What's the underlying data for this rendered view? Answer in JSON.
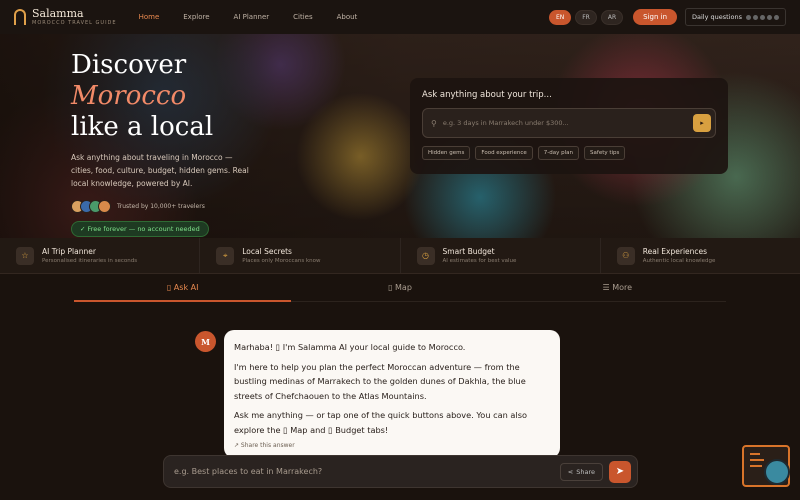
{
  "nav": {
    "brand": "Salamma",
    "brand_sub": "MOROCCO TRAVEL GUIDE",
    "menu": [
      "Home",
      "Explore",
      "AI Planner",
      "Cities",
      "About"
    ],
    "active_menu": "Home",
    "langs": [
      "EN",
      "FR",
      "AR"
    ],
    "signin": "Sign in",
    "daily": "Daily questions"
  },
  "hero": {
    "title_line1_a": "Discover ",
    "title_line1_b": "Morocco",
    "title_line2": "like a local",
    "description": "Ask anything about traveling in Morocco — cities, food, culture, budget, hidden gems. Real local knowledge, powered by AI.",
    "trust": "Trusted by 10,000+ travelers",
    "free_badge": "✓ Free forever — no account needed",
    "avatar_colors": [
      "#d8a060",
      "#3a6aaa",
      "#4a9a6a",
      "#d88a4a"
    ]
  },
  "ask": {
    "title": "Ask anything about your trip...",
    "placeholder": "e.g. 3 days in Marrakech under $300...",
    "chips": [
      "Hidden gems",
      "Food experience",
      "7-day plan",
      "Safety tips"
    ]
  },
  "features": [
    {
      "icon": "star-icon",
      "glyph": "☆",
      "title": "AI Trip Planner",
      "sub": "Personalised itineraries in seconds"
    },
    {
      "icon": "pin-icon",
      "glyph": "⌖",
      "title": "Local Secrets",
      "sub": "Places only Moroccans know"
    },
    {
      "icon": "clock-icon",
      "glyph": "◷",
      "title": "Smart Budget",
      "sub": "AI estimates for best value"
    },
    {
      "icon": "people-icon",
      "glyph": "⚇",
      "title": "Real Experiences",
      "sub": "Authentic local knowledge"
    }
  ],
  "tabs": [
    {
      "label": "▯ Ask AI"
    },
    {
      "label": "▯ Map"
    },
    {
      "label": "☰ More"
    }
  ],
  "chat": {
    "avatar_letter": "M",
    "p1": "Marhaba! ▯ I'm Salamma AI your local guide to Morocco.",
    "p2": "I'm here to help you plan the perfect Moroccan adventure — from the bustling medinas of Marrakech to the golden dunes of Dakhla, the blue streets of Chefchaouen to the Atlas Mountains.",
    "p3": "Ask me anything — or tap one of the quick buttons above. You can also explore the ▯ Map and ▯ Budget tabs!",
    "share_answer": "↗ Share this answer"
  },
  "input": {
    "placeholder": "e.g. Best places to eat in Marrakech?",
    "share": "Share",
    "send_icon": "➤"
  },
  "colors": {
    "accent": "#c9562d",
    "gold": "#d8a040",
    "background": "#1a120d"
  }
}
